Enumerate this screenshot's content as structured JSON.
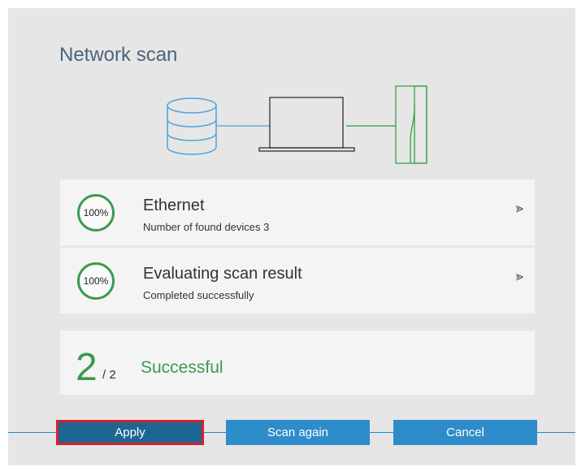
{
  "dialog": {
    "title": "Network scan"
  },
  "diagram": {
    "icons": [
      "database-icon",
      "laptop-icon",
      "device-icon"
    ],
    "colors": {
      "database": "#4aa3e0",
      "laptop": "#222222",
      "device": "#2a9d3a"
    }
  },
  "steps": [
    {
      "progress": "100%",
      "title": "Ethernet",
      "subtitle": "Number of found devices 3"
    },
    {
      "progress": "100%",
      "title": "Evaluating scan result",
      "subtitle": "Completed successfully"
    }
  ],
  "result": {
    "count": "2",
    "total": "/ 2",
    "status": "Successful"
  },
  "buttons": {
    "apply": "Apply",
    "scan_again": "Scan again",
    "cancel": "Cancel"
  },
  "colors": {
    "success": "#3c9a4e",
    "button": "#2f8cca",
    "button_selected": "#1d6691",
    "selection_border": "#d9202a"
  }
}
